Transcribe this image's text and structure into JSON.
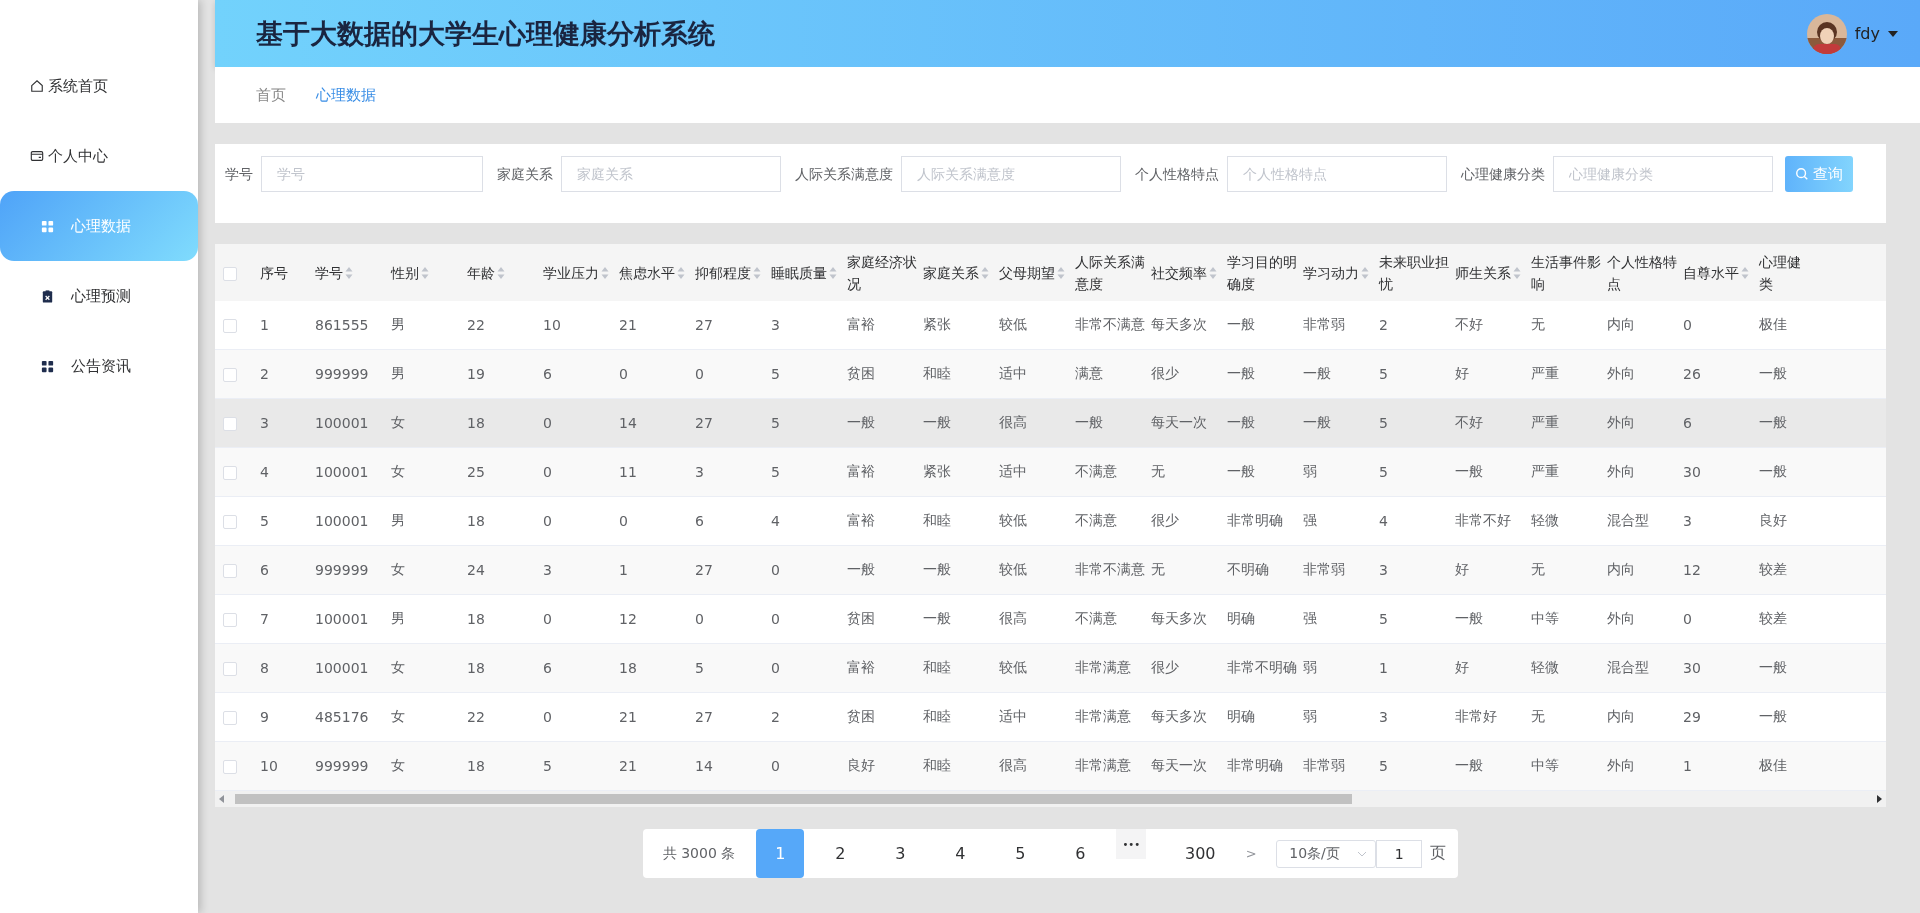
{
  "sidebar": {
    "items": [
      {
        "label": "系统首页",
        "selected": false
      },
      {
        "label": "个人中心",
        "selected": false
      },
      {
        "label": "心理数据",
        "selected": true
      },
      {
        "label": "心理预测",
        "selected": false
      },
      {
        "label": "公告资讯",
        "selected": false
      }
    ]
  },
  "header": {
    "title": "基于大数据的大学生心理健康分析系统",
    "user": "fdy"
  },
  "breadcrumb": [
    {
      "label": "首页",
      "selected": false
    },
    {
      "label": "心理数据",
      "selected": true
    }
  ],
  "filters": [
    {
      "label": "学号",
      "placeholder": "学号"
    },
    {
      "label": "家庭关系",
      "placeholder": "家庭关系"
    },
    {
      "label": "人际关系满意度",
      "placeholder": "人际关系满意度"
    },
    {
      "label": "个人性格特点",
      "placeholder": "个人性格特点"
    },
    {
      "label": "心理健康分类",
      "placeholder": "心理健康分类"
    }
  ],
  "query_button": "查询",
  "table": {
    "all_checked": false,
    "columns": [
      {
        "label": "序号",
        "sortable": false
      },
      {
        "label": "学号",
        "sortable": true
      },
      {
        "label": "性别",
        "sortable": true
      },
      {
        "label": "年龄",
        "sortable": true
      },
      {
        "label": "学业压力",
        "sortable": true
      },
      {
        "label": "焦虑水平",
        "sortable": true
      },
      {
        "label": "抑郁程度",
        "sortable": true
      },
      {
        "label": "睡眠质量",
        "sortable": true
      },
      {
        "label": "家庭经济状况",
        "sortable": false
      },
      {
        "label": "家庭关系",
        "sortable": true
      },
      {
        "label": "父母期望",
        "sortable": true
      },
      {
        "label": "人际关系满意度",
        "sortable": false
      },
      {
        "label": "社交频率",
        "sortable": true
      },
      {
        "label": "学习目的明确度",
        "sortable": false
      },
      {
        "label": "学习动力",
        "sortable": true
      },
      {
        "label": "未来职业担忧",
        "sortable": false
      },
      {
        "label": "师生关系",
        "sortable": true
      },
      {
        "label": "生活事件影响",
        "sortable": false
      },
      {
        "label": "个人性格特点",
        "sortable": false
      },
      {
        "label": "自尊水平",
        "sortable": true
      },
      {
        "label": "心理健类",
        "sortable": false
      }
    ],
    "rows": [
      {
        "checked": false,
        "hovered": false,
        "cells": [
          "1",
          "861555",
          "男",
          "22",
          "10",
          "21",
          "27",
          "3",
          "富裕",
          "紧张",
          "较低",
          "非常不满意",
          "每天多次",
          "一般",
          "非常弱",
          "2",
          "不好",
          "无",
          "内向",
          "0",
          "极佳"
        ]
      },
      {
        "checked": false,
        "hovered": false,
        "cells": [
          "2",
          "999999",
          "男",
          "19",
          "6",
          "0",
          "0",
          "5",
          "贫困",
          "和睦",
          "适中",
          "满意",
          "很少",
          "一般",
          "一般",
          "5",
          "好",
          "严重",
          "外向",
          "26",
          "一般"
        ]
      },
      {
        "checked": false,
        "hovered": true,
        "cells": [
          "3",
          "100001",
          "女",
          "18",
          "0",
          "14",
          "27",
          "5",
          "一般",
          "一般",
          "很高",
          "一般",
          "每天一次",
          "一般",
          "一般",
          "5",
          "不好",
          "严重",
          "外向",
          "6",
          "一般"
        ]
      },
      {
        "checked": false,
        "hovered": false,
        "cells": [
          "4",
          "100001",
          "女",
          "25",
          "0",
          "11",
          "3",
          "5",
          "富裕",
          "紧张",
          "适中",
          "不满意",
          "无",
          "一般",
          "弱",
          "5",
          "一般",
          "严重",
          "外向",
          "30",
          "一般"
        ]
      },
      {
        "checked": false,
        "hovered": false,
        "cells": [
          "5",
          "100001",
          "男",
          "18",
          "0",
          "0",
          "6",
          "4",
          "富裕",
          "和睦",
          "较低",
          "不满意",
          "很少",
          "非常明确",
          "强",
          "4",
          "非常不好",
          "轻微",
          "混合型",
          "3",
          "良好"
        ]
      },
      {
        "checked": false,
        "hovered": false,
        "cells": [
          "6",
          "999999",
          "女",
          "24",
          "3",
          "1",
          "27",
          "0",
          "一般",
          "一般",
          "较低",
          "非常不满意",
          "无",
          "不明确",
          "非常弱",
          "3",
          "好",
          "无",
          "内向",
          "12",
          "较差"
        ]
      },
      {
        "checked": false,
        "hovered": false,
        "cells": [
          "7",
          "100001",
          "男",
          "18",
          "0",
          "12",
          "0",
          "0",
          "贫困",
          "一般",
          "很高",
          "不满意",
          "每天多次",
          "明确",
          "强",
          "5",
          "一般",
          "中等",
          "外向",
          "0",
          "较差"
        ]
      },
      {
        "checked": false,
        "hovered": false,
        "cells": [
          "8",
          "100001",
          "女",
          "18",
          "6",
          "18",
          "5",
          "0",
          "富裕",
          "和睦",
          "较低",
          "非常满意",
          "很少",
          "非常不明确",
          "弱",
          "1",
          "好",
          "轻微",
          "混合型",
          "30",
          "一般"
        ]
      },
      {
        "checked": false,
        "hovered": false,
        "cells": [
          "9",
          "485176",
          "女",
          "22",
          "0",
          "21",
          "27",
          "2",
          "贫困",
          "和睦",
          "适中",
          "非常满意",
          "每天多次",
          "明确",
          "弱",
          "3",
          "非常好",
          "无",
          "内向",
          "29",
          "一般"
        ]
      },
      {
        "checked": false,
        "hovered": false,
        "cells": [
          "10",
          "999999",
          "女",
          "18",
          "5",
          "21",
          "14",
          "0",
          "良好",
          "和睦",
          "很高",
          "非常满意",
          "每天一次",
          "非常明确",
          "非常弱",
          "5",
          "一般",
          "中等",
          "外向",
          "1",
          "极佳"
        ]
      }
    ]
  },
  "pagination": {
    "total": "共 3000 条",
    "pages": [
      {
        "kind": "page",
        "label": "1",
        "selected": true
      },
      {
        "kind": "page",
        "label": "2",
        "selected": false
      },
      {
        "kind": "page",
        "label": "3",
        "selected": false
      },
      {
        "kind": "page",
        "label": "4",
        "selected": false
      },
      {
        "kind": "page",
        "label": "5",
        "selected": false
      },
      {
        "kind": "page",
        "label": "6",
        "selected": false
      },
      {
        "kind": "more",
        "label": "•••",
        "selected": false
      },
      {
        "kind": "page",
        "label": "300",
        "selected": false
      }
    ],
    "next": ">",
    "page_size": "10条/页",
    "jump_value": "1",
    "jump_suffix": "页"
  }
}
